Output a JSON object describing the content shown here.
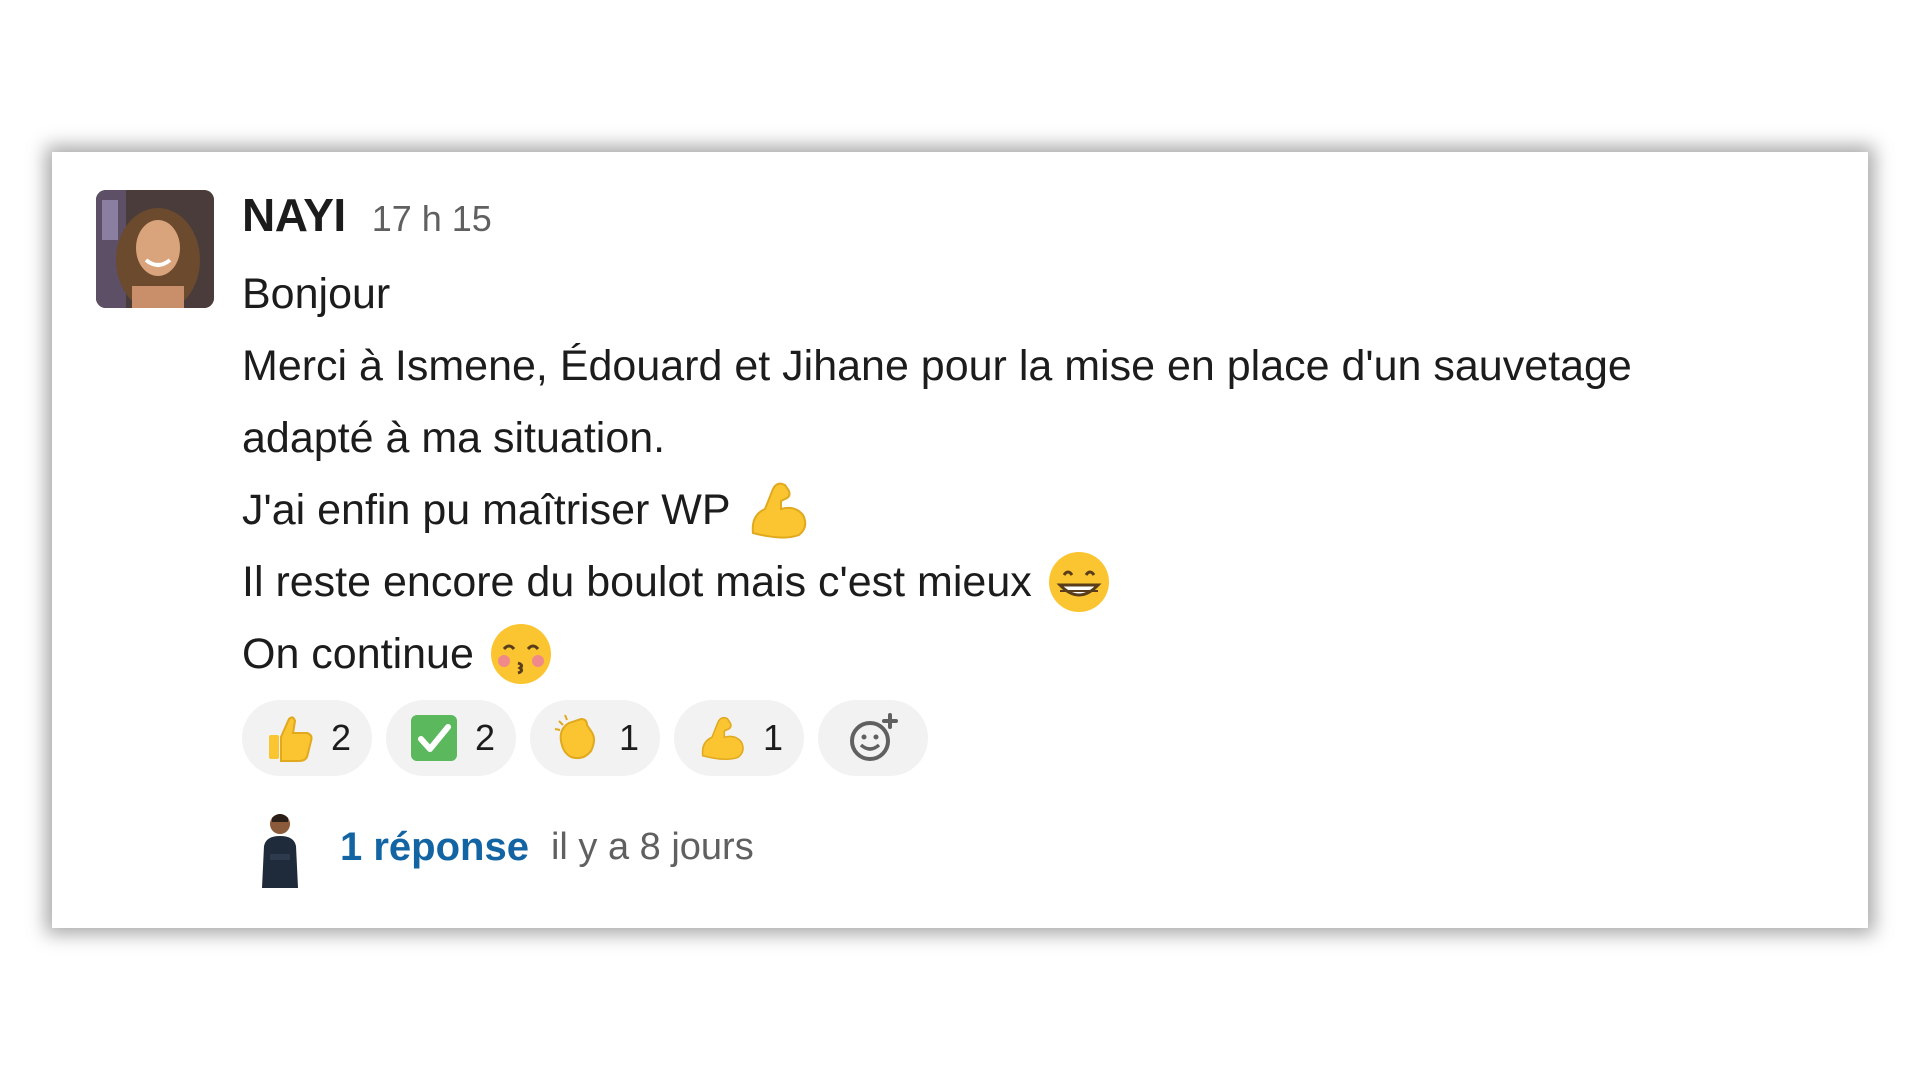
{
  "message": {
    "author": "NAYI",
    "time": "17 h 15",
    "lines": [
      "Bonjour",
      "Merci à Ismene, Édouard et Jihane pour la mise en place d'un sauvetage",
      "adapté à ma situation.",
      "J'ai enfin pu maîtriser WP",
      "Il reste encore du boulot mais c'est mieux",
      "On continue"
    ],
    "line_emojis": [
      "",
      "",
      "",
      "flexed-biceps-icon",
      "grinning-face-icon",
      "kissing-face-icon"
    ]
  },
  "reactions": [
    {
      "emoji": "thumbs-up-icon",
      "count": "2"
    },
    {
      "emoji": "check-mark-icon",
      "count": "2"
    },
    {
      "emoji": "clapping-hands-icon",
      "count": "1"
    },
    {
      "emoji": "flexed-biceps-icon",
      "count": "1"
    }
  ],
  "add_reaction": {
    "icon": "add-reaction-icon"
  },
  "thread": {
    "reply_count_label": "1 réponse",
    "last_reply": "il y a 8 jours"
  },
  "colors": {
    "link": "#1264a3",
    "text": "#1d1c1d",
    "muted": "#616061",
    "reaction_bg": "#f2f2f2",
    "emoji_yellow": "#fbc531"
  }
}
